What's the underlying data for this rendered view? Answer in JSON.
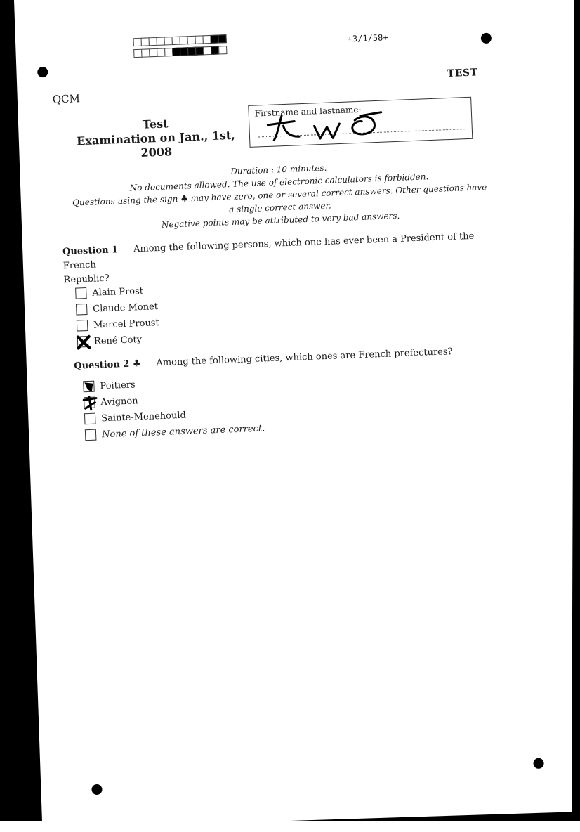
{
  "header": {
    "page_id": "+3/1/58+",
    "test_label": "TEST",
    "qcm_label": "QCM",
    "code_row1": [
      0,
      0,
      0,
      0,
      0,
      0,
      0,
      0,
      0,
      0,
      1,
      1
    ],
    "code_row2": [
      0,
      0,
      0,
      0,
      0,
      1,
      1,
      1,
      1,
      0,
      1,
      0
    ]
  },
  "title": {
    "line1": "Test",
    "line2": "Examination on Jan., 1st,",
    "line3": "2008"
  },
  "name_box": {
    "label": "Firstname and lastname:",
    "handwriting": "two"
  },
  "instructions": {
    "duration": "Duration : 10 minutes.",
    "line1": "No documents allowed. The use of electronic calculators is forbidden.",
    "line2": "Questions using the sign ♣ may have zero, one or several correct answers. Other questions have",
    "line3": "a single correct answer.",
    "line4": "Negative points may be attributed to very bad answers."
  },
  "questions": [
    {
      "number": "Question 1",
      "text": "Among the following persons, which one has ever been a President of the French",
      "text_cont": "Republic?",
      "answers": [
        {
          "label": "Alain Prost",
          "checked": false
        },
        {
          "label": "Claude Monet",
          "checked": false
        },
        {
          "label": "Marcel Proust",
          "checked": false
        },
        {
          "label": "René Coty",
          "checked": true
        }
      ]
    },
    {
      "number": "Question 2 ♣",
      "text": "Among the following cities, which ones are French prefectures?",
      "answers": [
        {
          "label": "Poitiers",
          "checked": true
        },
        {
          "label": "Avignon",
          "checked": true
        },
        {
          "label": "Sainte-Menehould",
          "checked": false
        },
        {
          "label": "None of these answers are correct.",
          "checked": false
        }
      ]
    }
  ]
}
